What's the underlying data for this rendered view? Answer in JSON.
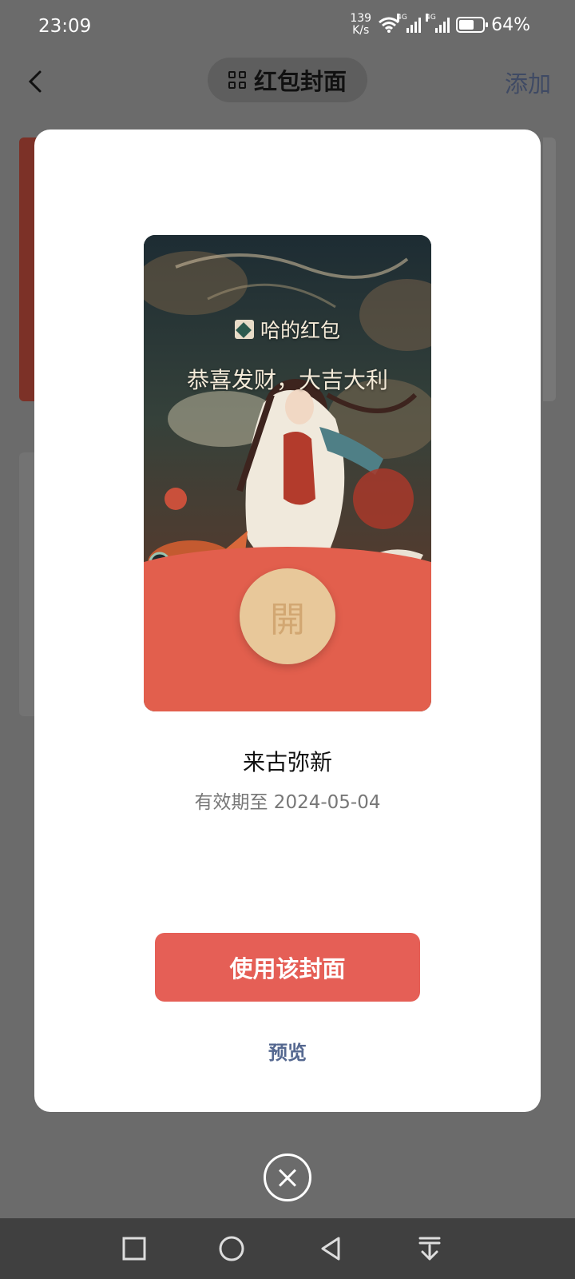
{
  "status_bar": {
    "time": "23:09",
    "net_speed_value": "139",
    "net_speed_unit": "K/s",
    "signal_tag_1": "4G",
    "signal_tag_2": "4G",
    "battery_percent": "64%",
    "battery_level": 0.64
  },
  "header": {
    "title": "红包封面",
    "add_label": "添加"
  },
  "modal": {
    "cover": {
      "sender_text": "哈的红包",
      "blessing": "恭喜发财，大吉大利",
      "open_char": "開",
      "colors": {
        "bottom": "#e25f4d",
        "open_button": "#e8c89a"
      }
    },
    "cover_name": "来古弥新",
    "expiry": "有效期至 2024-05-04",
    "use_button_label": "使用该封面",
    "preview_label": "预览",
    "accent_color": "#e55f56"
  },
  "icons": {
    "back": "chevron-left-icon",
    "title": "grid-icon",
    "close": "close-circle-icon",
    "nav": [
      "square-icon",
      "circle-icon",
      "triangle-back-icon",
      "download-icon"
    ]
  }
}
